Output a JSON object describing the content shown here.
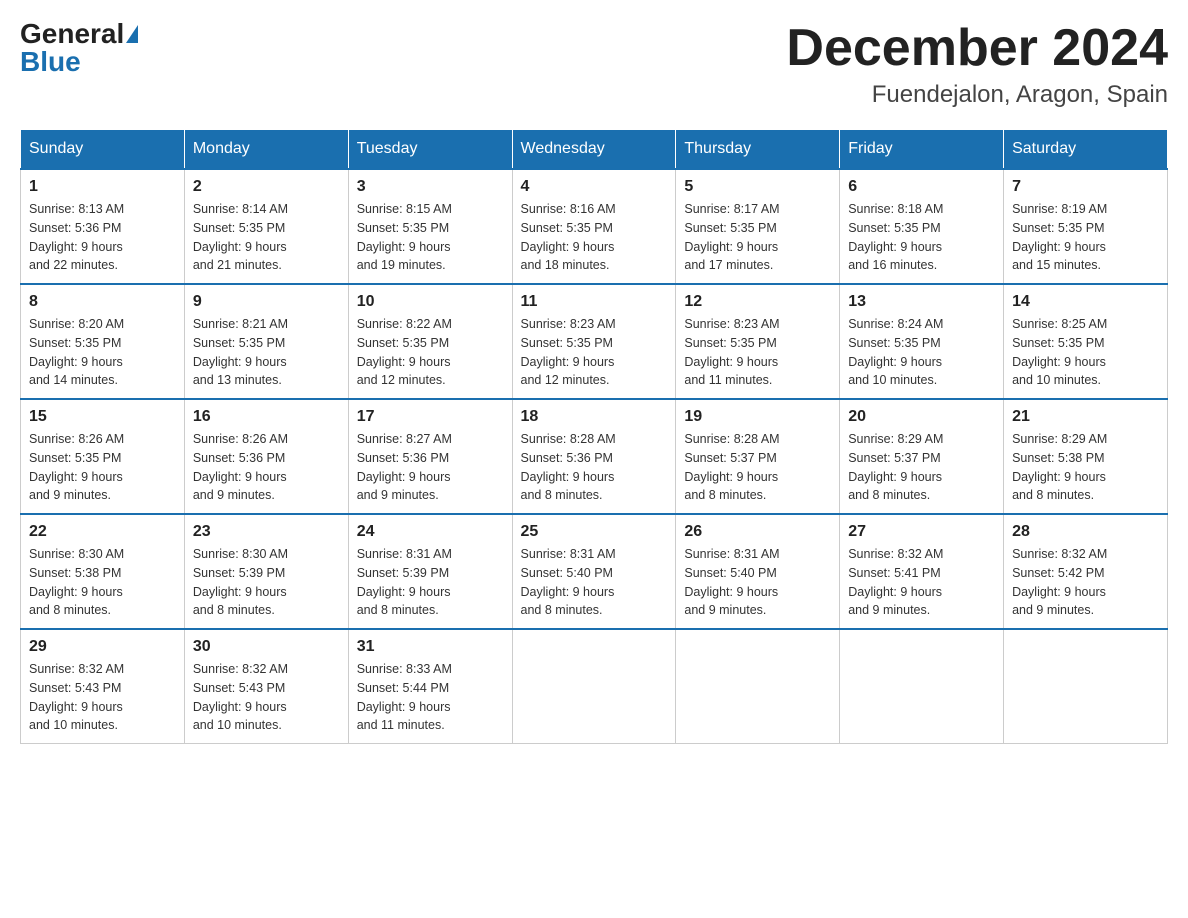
{
  "header": {
    "logo_general": "General",
    "logo_blue": "Blue",
    "month_title": "December 2024",
    "location": "Fuendejalon, Aragon, Spain"
  },
  "weekdays": [
    "Sunday",
    "Monday",
    "Tuesday",
    "Wednesday",
    "Thursday",
    "Friday",
    "Saturday"
  ],
  "weeks": [
    [
      {
        "day": "1",
        "sunrise": "8:13 AM",
        "sunset": "5:36 PM",
        "daylight": "9 hours and 22 minutes."
      },
      {
        "day": "2",
        "sunrise": "8:14 AM",
        "sunset": "5:35 PM",
        "daylight": "9 hours and 21 minutes."
      },
      {
        "day": "3",
        "sunrise": "8:15 AM",
        "sunset": "5:35 PM",
        "daylight": "9 hours and 19 minutes."
      },
      {
        "day": "4",
        "sunrise": "8:16 AM",
        "sunset": "5:35 PM",
        "daylight": "9 hours and 18 minutes."
      },
      {
        "day": "5",
        "sunrise": "8:17 AM",
        "sunset": "5:35 PM",
        "daylight": "9 hours and 17 minutes."
      },
      {
        "day": "6",
        "sunrise": "8:18 AM",
        "sunset": "5:35 PM",
        "daylight": "9 hours and 16 minutes."
      },
      {
        "day": "7",
        "sunrise": "8:19 AM",
        "sunset": "5:35 PM",
        "daylight": "9 hours and 15 minutes."
      }
    ],
    [
      {
        "day": "8",
        "sunrise": "8:20 AM",
        "sunset": "5:35 PM",
        "daylight": "9 hours and 14 minutes."
      },
      {
        "day": "9",
        "sunrise": "8:21 AM",
        "sunset": "5:35 PM",
        "daylight": "9 hours and 13 minutes."
      },
      {
        "day": "10",
        "sunrise": "8:22 AM",
        "sunset": "5:35 PM",
        "daylight": "9 hours and 12 minutes."
      },
      {
        "day": "11",
        "sunrise": "8:23 AM",
        "sunset": "5:35 PM",
        "daylight": "9 hours and 12 minutes."
      },
      {
        "day": "12",
        "sunrise": "8:23 AM",
        "sunset": "5:35 PM",
        "daylight": "9 hours and 11 minutes."
      },
      {
        "day": "13",
        "sunrise": "8:24 AM",
        "sunset": "5:35 PM",
        "daylight": "9 hours and 10 minutes."
      },
      {
        "day": "14",
        "sunrise": "8:25 AM",
        "sunset": "5:35 PM",
        "daylight": "9 hours and 10 minutes."
      }
    ],
    [
      {
        "day": "15",
        "sunrise": "8:26 AM",
        "sunset": "5:35 PM",
        "daylight": "9 hours and 9 minutes."
      },
      {
        "day": "16",
        "sunrise": "8:26 AM",
        "sunset": "5:36 PM",
        "daylight": "9 hours and 9 minutes."
      },
      {
        "day": "17",
        "sunrise": "8:27 AM",
        "sunset": "5:36 PM",
        "daylight": "9 hours and 9 minutes."
      },
      {
        "day": "18",
        "sunrise": "8:28 AM",
        "sunset": "5:36 PM",
        "daylight": "9 hours and 8 minutes."
      },
      {
        "day": "19",
        "sunrise": "8:28 AM",
        "sunset": "5:37 PM",
        "daylight": "9 hours and 8 minutes."
      },
      {
        "day": "20",
        "sunrise": "8:29 AM",
        "sunset": "5:37 PM",
        "daylight": "9 hours and 8 minutes."
      },
      {
        "day": "21",
        "sunrise": "8:29 AM",
        "sunset": "5:38 PM",
        "daylight": "9 hours and 8 minutes."
      }
    ],
    [
      {
        "day": "22",
        "sunrise": "8:30 AM",
        "sunset": "5:38 PM",
        "daylight": "9 hours and 8 minutes."
      },
      {
        "day": "23",
        "sunrise": "8:30 AM",
        "sunset": "5:39 PM",
        "daylight": "9 hours and 8 minutes."
      },
      {
        "day": "24",
        "sunrise": "8:31 AM",
        "sunset": "5:39 PM",
        "daylight": "9 hours and 8 minutes."
      },
      {
        "day": "25",
        "sunrise": "8:31 AM",
        "sunset": "5:40 PM",
        "daylight": "9 hours and 8 minutes."
      },
      {
        "day": "26",
        "sunrise": "8:31 AM",
        "sunset": "5:40 PM",
        "daylight": "9 hours and 9 minutes."
      },
      {
        "day": "27",
        "sunrise": "8:32 AM",
        "sunset": "5:41 PM",
        "daylight": "9 hours and 9 minutes."
      },
      {
        "day": "28",
        "sunrise": "8:32 AM",
        "sunset": "5:42 PM",
        "daylight": "9 hours and 9 minutes."
      }
    ],
    [
      {
        "day": "29",
        "sunrise": "8:32 AM",
        "sunset": "5:43 PM",
        "daylight": "9 hours and 10 minutes."
      },
      {
        "day": "30",
        "sunrise": "8:32 AM",
        "sunset": "5:43 PM",
        "daylight": "9 hours and 10 minutes."
      },
      {
        "day": "31",
        "sunrise": "8:33 AM",
        "sunset": "5:44 PM",
        "daylight": "9 hours and 11 minutes."
      },
      null,
      null,
      null,
      null
    ]
  ]
}
